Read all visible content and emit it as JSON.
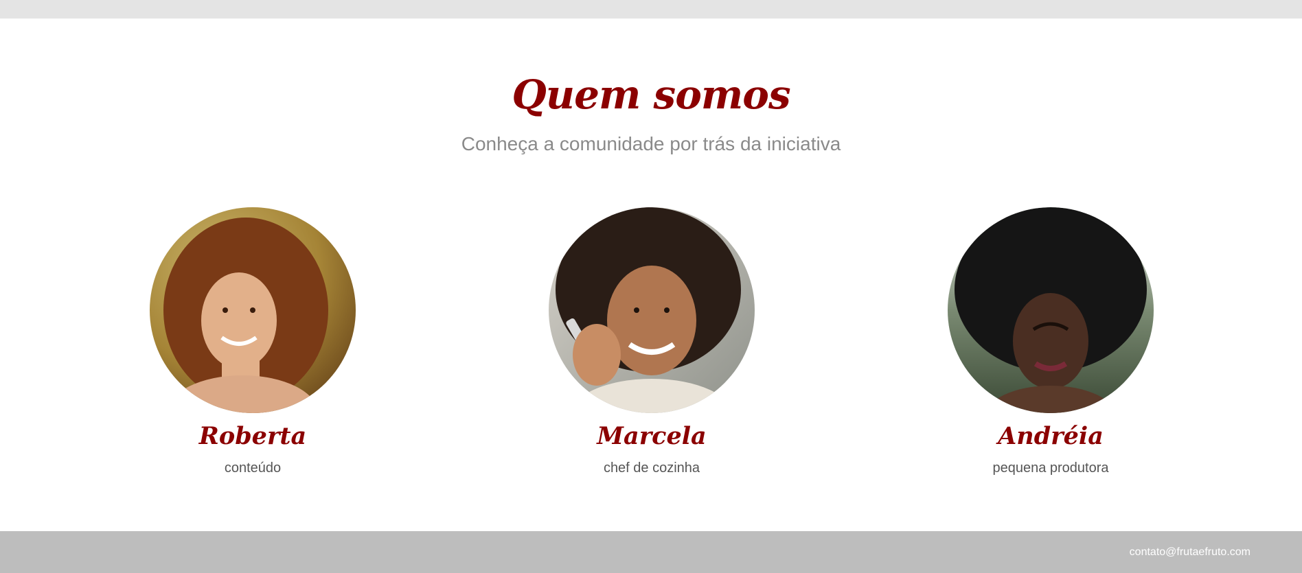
{
  "section": {
    "title": "Quem somos",
    "subtitle": "Conheça a comunidade por trás da iniciativa"
  },
  "members": [
    {
      "name": "Roberta",
      "role": "conteúdo"
    },
    {
      "name": "Marcela",
      "role": "chef de cozinha"
    },
    {
      "name": "Andréia",
      "role": "pequena produtora"
    }
  ],
  "footer": {
    "email": "contato@frutaefruto.com"
  },
  "colors": {
    "accent": "#8b0000",
    "top_bar": "#e4e4e4",
    "footer_bg": "#bdbdbd"
  }
}
